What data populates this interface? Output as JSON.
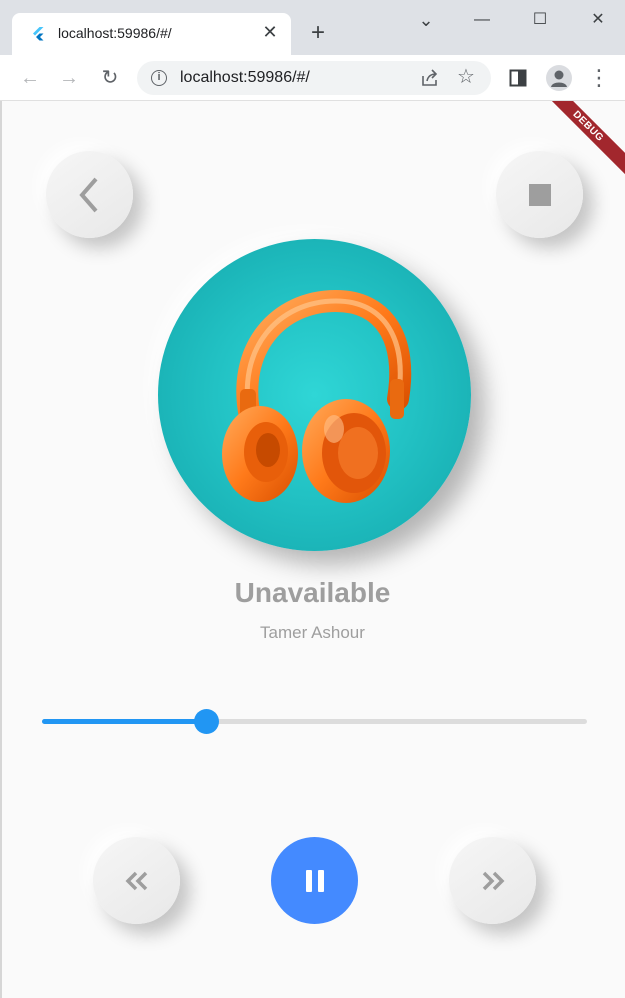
{
  "browser": {
    "tab_title": "localhost:59986/#/",
    "tab_close": "✕",
    "new_tab": "+",
    "url": "localhost:59986/#/",
    "window_controls": {
      "minimize": "—",
      "maximize": "☐",
      "close": "✕",
      "tab_search": "⌄"
    },
    "nav": {
      "back": "←",
      "forward": "→",
      "reload": "↻"
    },
    "star": "☆",
    "menu": "⋮"
  },
  "debug_banner": "DEBUG",
  "player": {
    "title": "Unavailable",
    "artist": "Tamer Ashour",
    "progress": 0.3,
    "is_playing": true
  },
  "colors": {
    "accent": "#2196f3",
    "play_button": "#448aff",
    "artwork_bg": "#22c2c4",
    "headphone": "#ff7a1a",
    "debug_banner": "#a2272d"
  },
  "icons": {
    "back": "chevron-left-icon",
    "stop": "stop-icon",
    "previous": "double-chevron-left-icon",
    "pause": "pause-icon",
    "next": "double-chevron-right-icon",
    "artwork": "headphones-icon"
  }
}
